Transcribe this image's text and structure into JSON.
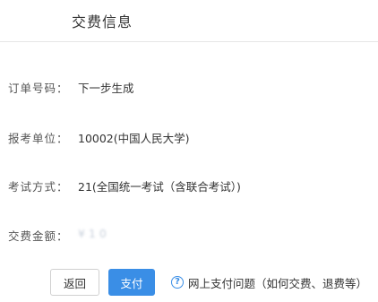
{
  "header": {
    "title": "交费信息"
  },
  "fields": [
    {
      "label": "订单号码：",
      "value": "下一步生成"
    },
    {
      "label": "报考单位：",
      "value": "10002(中国人民大学)"
    },
    {
      "label": "考试方式：",
      "value": "21(全国统一考试（含联合考试）)"
    },
    {
      "label": "交费金额：",
      "value": "¥ 1 0"
    }
  ],
  "actions": {
    "back_label": "返回",
    "pay_label": "支付",
    "help_icon": "?",
    "help_label": "网上支付问题（如何交费、退费等）"
  },
  "colors": {
    "primary": "#3a8ee6",
    "border": "#d0d0d0",
    "text": "#333333"
  }
}
